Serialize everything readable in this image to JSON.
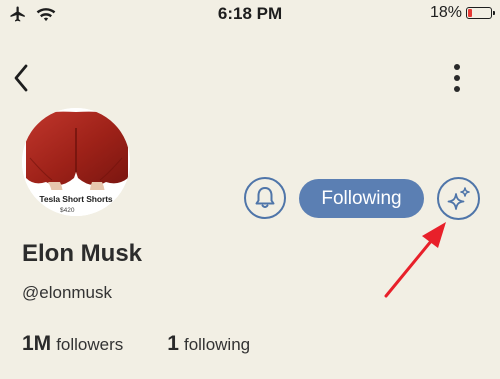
{
  "status_bar": {
    "time": "6:18 PM",
    "battery_percent": "18%",
    "battery_level": 0.18,
    "icons": [
      "airplane-icon",
      "wifi-icon",
      "battery-icon"
    ]
  },
  "nav": {
    "back_icon": "chevron-left-icon",
    "more_icon": "vertical-ellipsis-icon"
  },
  "avatar": {
    "caption": "Tesla Short Shorts",
    "price": "$420"
  },
  "actions": {
    "bell_icon": "bell-icon",
    "following_label": "Following",
    "sparkle_icon": "sparkle-icon"
  },
  "profile": {
    "name": "Elon Musk",
    "handle": "@elonmusk",
    "followers_count": "1M",
    "followers_label": "followers",
    "following_count": "1",
    "following_label": "following"
  },
  "colors": {
    "background": "#f2efe4",
    "accent": "#5b7fb3",
    "annotation": "#e8202a"
  }
}
